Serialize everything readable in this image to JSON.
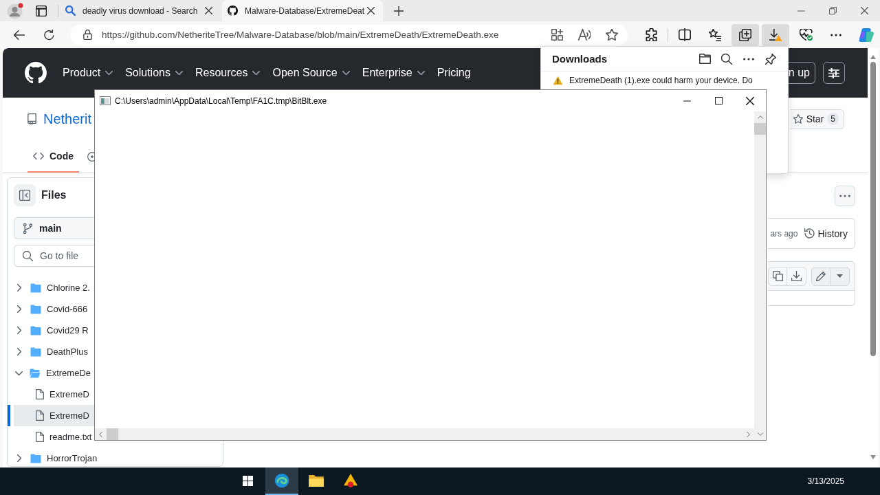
{
  "browser": {
    "tabs": [
      {
        "kind": "search",
        "title": "deadly virus download - Search",
        "selected": false
      },
      {
        "kind": "repository",
        "title": "Malware-Database/ExtremeDeat",
        "selected": true
      }
    ],
    "address_bar": {
      "url": "https://github.com/NetheriteTree/Malware-Database/blob/main/ExtremeDeath/ExtremeDeath.exe"
    },
    "toolbar": [
      {
        "kind": "extensions",
        "active": false
      },
      {
        "kind": "split_screen",
        "active": false
      },
      {
        "kind": "favorites",
        "active": false
      },
      {
        "kind": "collections",
        "active": true
      },
      {
        "kind": "downloads",
        "active": true
      },
      {
        "kind": "essentials",
        "active": false
      },
      {
        "kind": "more",
        "active": false
      },
      {
        "kind": "copilot",
        "active": false
      }
    ]
  },
  "downloads_panel": {
    "title": "Downloads",
    "warning": "ExtremeDeath (1).exe could harm your device. Do"
  },
  "page": {
    "nav": [
      {
        "label": "Product",
        "menu": true
      },
      {
        "label": "Solutions",
        "menu": true
      },
      {
        "label": "Resources",
        "menu": true
      },
      {
        "label": "Open Source",
        "menu": true
      },
      {
        "label": "Enterprise",
        "menu": true
      },
      {
        "label": "Pricing",
        "menu": false
      }
    ],
    "sign_up": "n up",
    "repo": {
      "name": "Netherit",
      "star": "Star",
      "star_count": "5"
    },
    "repo_tabs": [
      {
        "label": "Code",
        "selected": true
      }
    ],
    "sidebar": {
      "title": "Files",
      "branch": "main",
      "search": {
        "placeholder": "Go to file"
      },
      "tree": [
        {
          "kind": "folder",
          "name": "Chlorine 2.",
          "expanded": false,
          "selected": false
        },
        {
          "kind": "folder",
          "name": "Covid-666",
          "expanded": false,
          "selected": false
        },
        {
          "kind": "folder",
          "name": "Covid29 R",
          "expanded": false,
          "selected": false
        },
        {
          "kind": "folder",
          "name": "DeathPlus",
          "expanded": false,
          "selected": false
        },
        {
          "kind": "folder",
          "name": "ExtremeDe",
          "expanded": true,
          "selected": false,
          "children": [
            {
              "kind": "file",
              "name": "ExtremeD",
              "selected": false
            },
            {
              "kind": "file",
              "name": "ExtremeD",
              "selected": true
            },
            {
              "kind": "file",
              "name": "readme.txt",
              "selected": false
            }
          ]
        },
        {
          "kind": "folder",
          "name": "HorrorTrojan",
          "expanded": false,
          "selected": false
        }
      ]
    },
    "file": {
      "commit_time": "ars ago",
      "history": "History"
    }
  },
  "app_window": {
    "title": "C:\\Users\\admin\\AppData\\Local\\Temp\\FA1C.tmp\\BitBlt.exe"
  },
  "taskbar": {
    "apps": [
      {
        "kind": "start",
        "active": false
      },
      {
        "kind": "browser",
        "active": true
      },
      {
        "kind": "files",
        "active": false
      },
      {
        "kind": "app",
        "active": false
      }
    ],
    "date": "3/13/2025"
  }
}
